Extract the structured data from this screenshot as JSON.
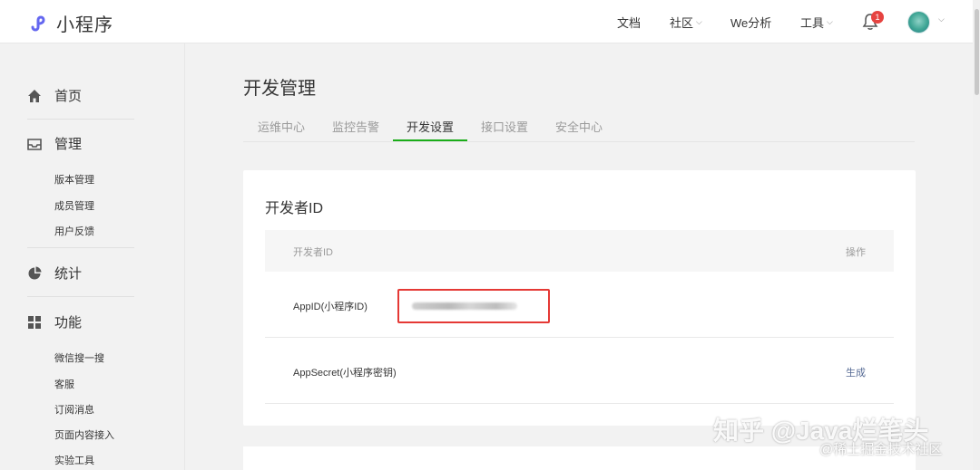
{
  "header": {
    "logo_text": "小程序",
    "nav": [
      {
        "label": "文档",
        "has_dropdown": false
      },
      {
        "label": "社区",
        "has_dropdown": true
      },
      {
        "label": "We分析",
        "has_dropdown": false
      },
      {
        "label": "工具",
        "has_dropdown": true
      }
    ],
    "notification_count": "1"
  },
  "sidebar": {
    "home": "首页",
    "manage": "管理",
    "manage_items": [
      "版本管理",
      "成员管理",
      "用户反馈"
    ],
    "stats": "统计",
    "features": "功能",
    "feature_items": [
      "微信搜一搜",
      "客服",
      "订阅消息",
      "页面内容接入",
      "实验工具"
    ]
  },
  "main": {
    "title": "开发管理",
    "tabs": [
      "运维中心",
      "监控告警",
      "开发设置",
      "接口设置",
      "安全中心"
    ],
    "active_tab": "开发设置",
    "card": {
      "title": "开发者ID",
      "columns": [
        "开发者ID",
        "操作"
      ],
      "rows": [
        {
          "label": "AppID(小程序ID)",
          "action": ""
        },
        {
          "label": "AppSecret(小程序密钥)",
          "action": "生成"
        }
      ]
    }
  },
  "watermark": {
    "line1": "知乎 @Java烂笔头",
    "line2": "@稀土掘金技术社区"
  },
  "colors": {
    "accent_green": "#1aad19",
    "link_blue": "#576b95",
    "highlight_red": "#e53935",
    "badge_red": "#e64340"
  }
}
